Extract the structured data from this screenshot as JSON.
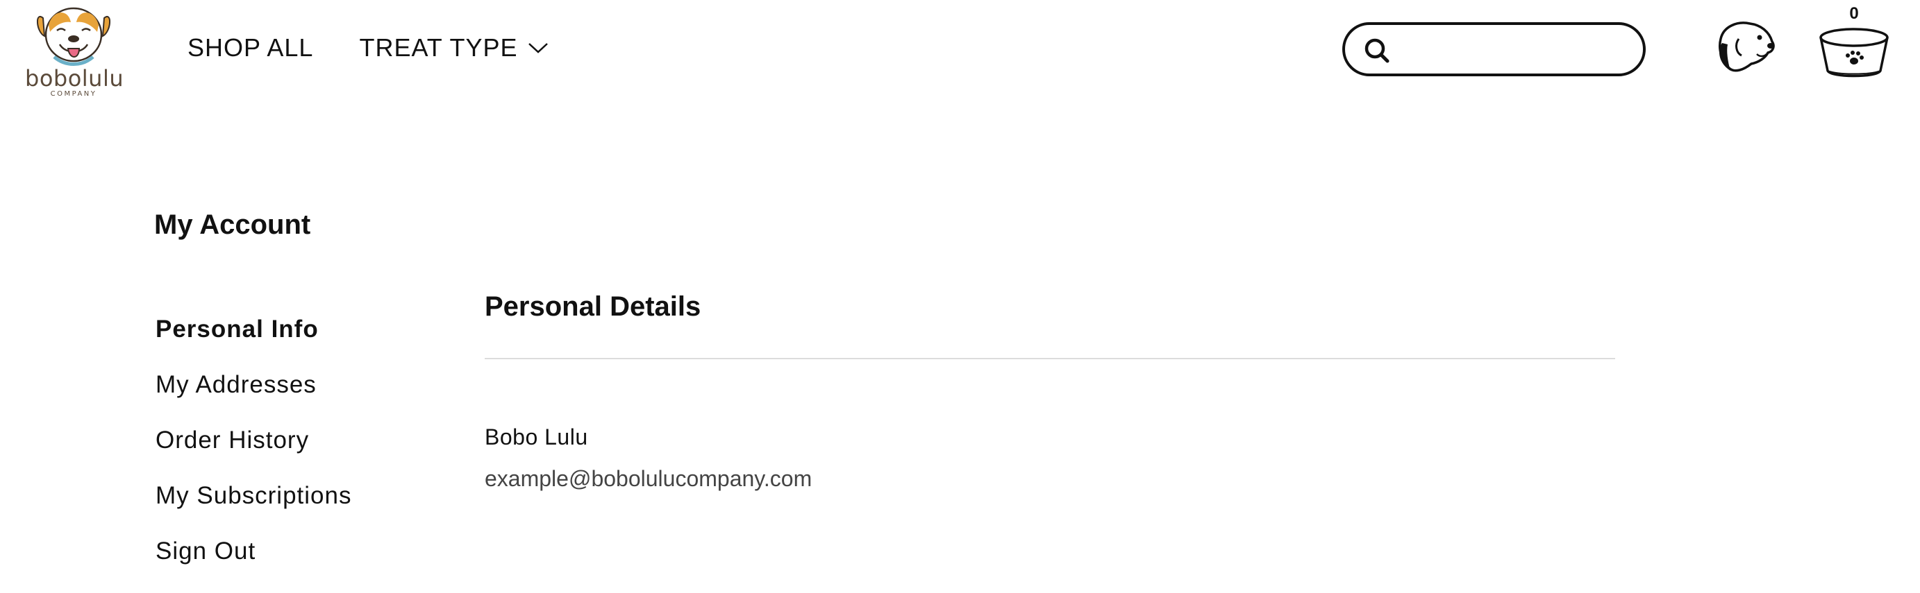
{
  "brand": {
    "name": "bobolulu",
    "tagline": "COMPANY"
  },
  "nav": {
    "shop_all": "SHOP ALL",
    "treat_type": "TREAT TYPE"
  },
  "search": {
    "placeholder": "",
    "value": ""
  },
  "header_icons": {
    "account": "dog-head-account-icon",
    "cart": "dog-bowl-cart-icon",
    "cart_count": "0"
  },
  "page": {
    "title": "My Account"
  },
  "sidebar": {
    "items": [
      {
        "label": "Personal Info",
        "active": true
      },
      {
        "label": "My Addresses",
        "active": false
      },
      {
        "label": "Order History",
        "active": false
      },
      {
        "label": "My Subscriptions",
        "active": false
      },
      {
        "label": "Sign Out",
        "active": false
      }
    ]
  },
  "personal_details": {
    "title": "Personal Details",
    "name": "Bobo Lulu",
    "email": "example@bobolulucompany.com"
  },
  "colors": {
    "text": "#111111",
    "muted": "#444444",
    "divider": "#dcdcdc",
    "logo_orange": "#e8a33a",
    "logo_brown": "#5b4a3a"
  }
}
